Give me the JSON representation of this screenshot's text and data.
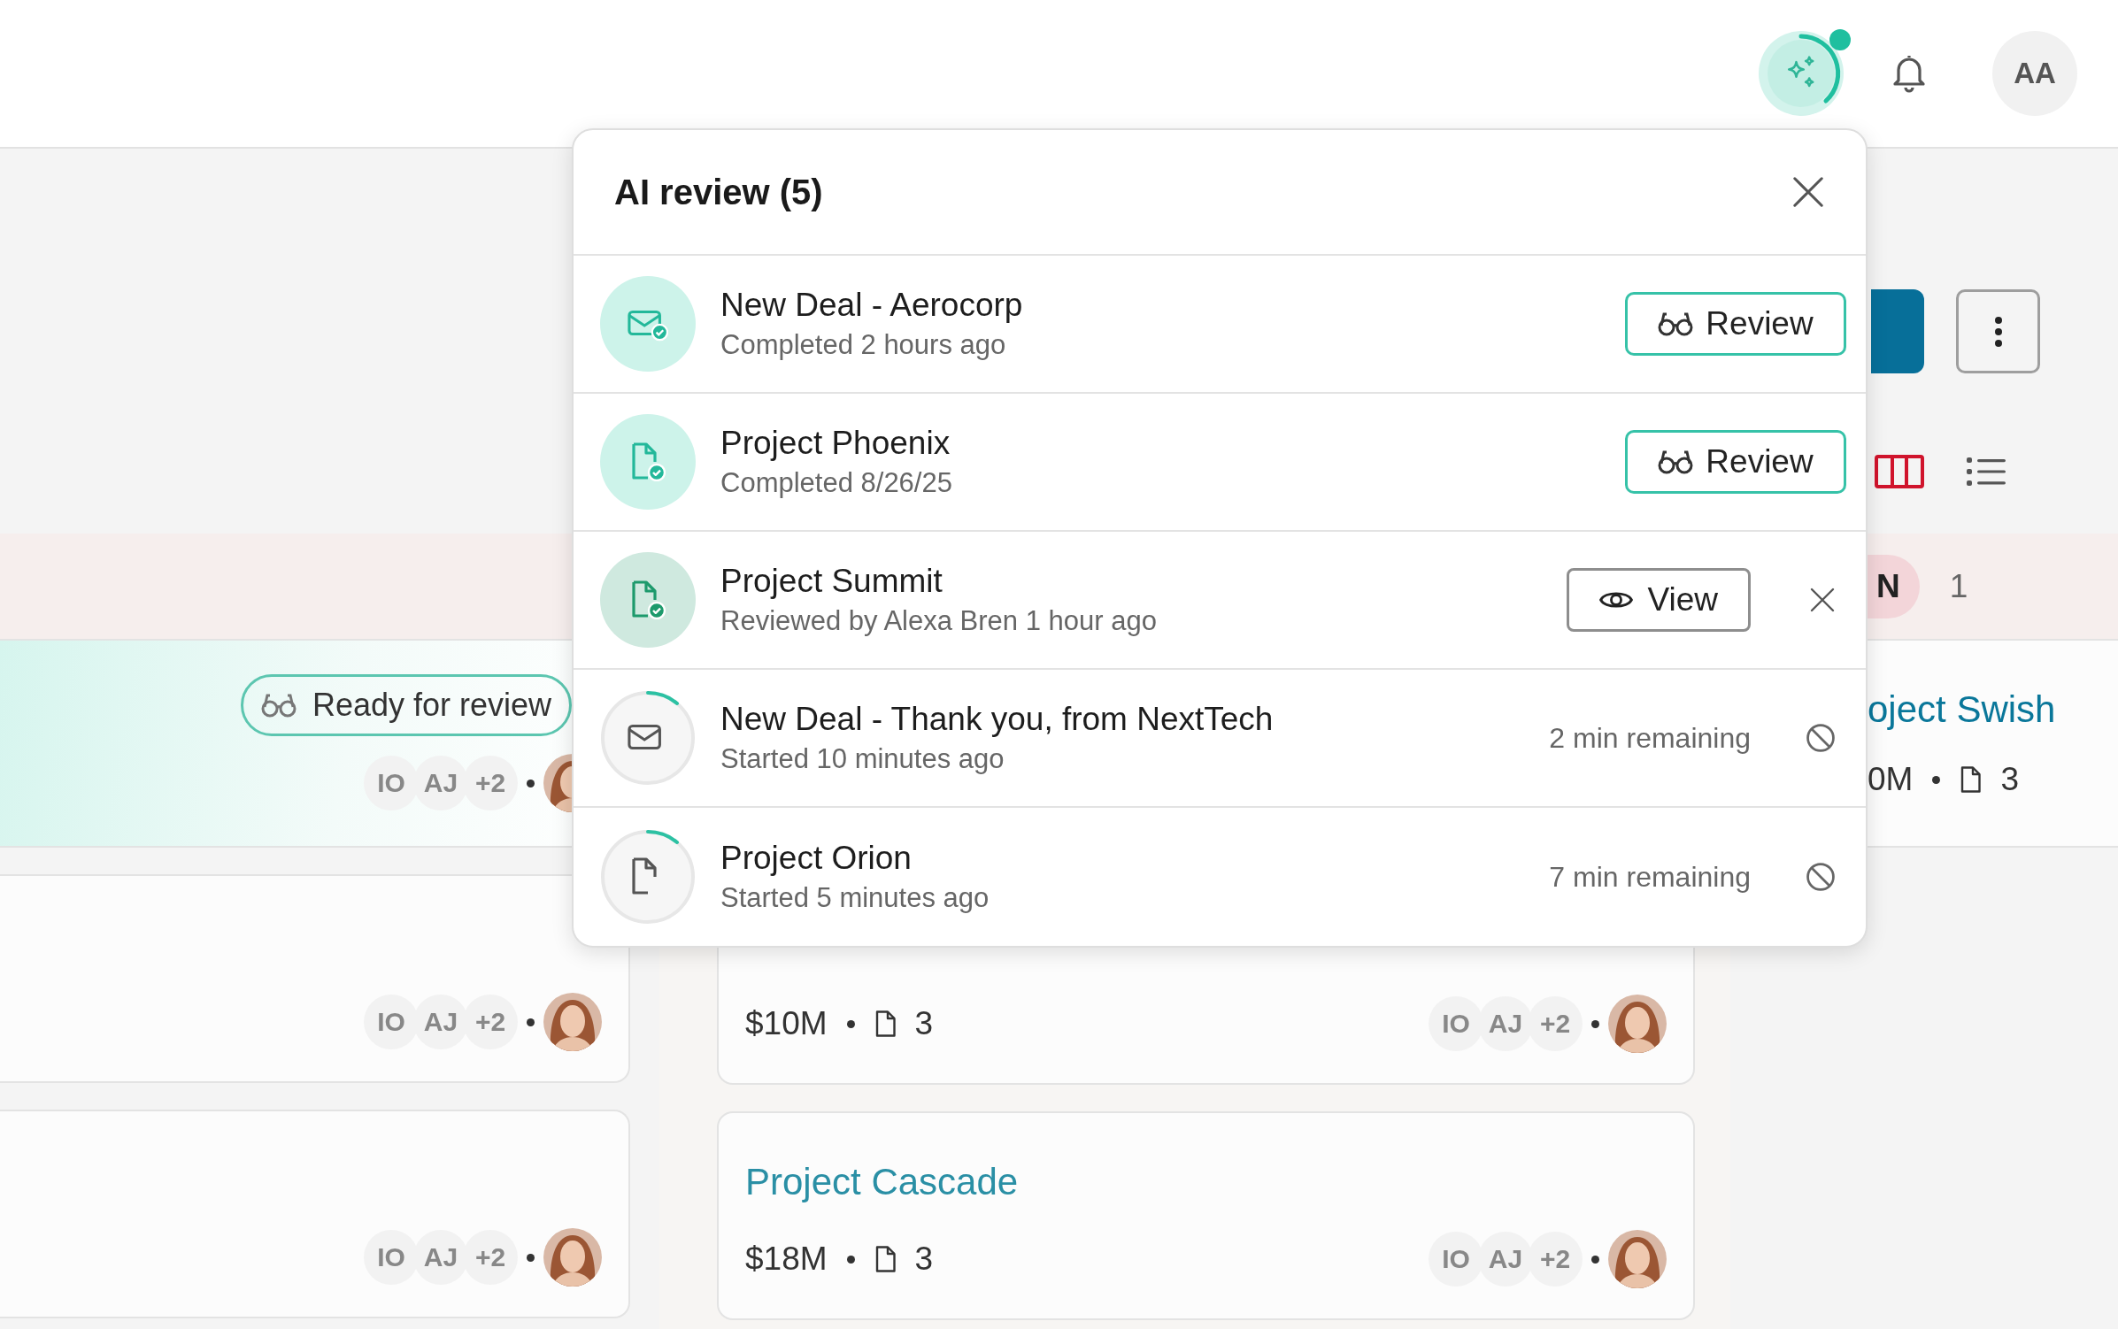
{
  "header": {
    "ai_button": {
      "notification": true
    },
    "user_avatar": "AA"
  },
  "toolbar": {
    "views": [
      {
        "kind": "board",
        "selected": true
      },
      {
        "kind": "list",
        "selected": false
      }
    ]
  },
  "band": {
    "badge": "N",
    "count": "1"
  },
  "lanes": [
    {
      "cards": [
        {
          "highlighted": true,
          "status_chip": "Ready for review",
          "people": [
            "IO",
            "AJ",
            "+2"
          ]
        },
        {
          "highlighted": false,
          "people": [
            "IO",
            "AJ",
            "+2"
          ]
        },
        {
          "highlighted": false,
          "people": [
            "IO",
            "AJ",
            "+2"
          ]
        }
      ]
    },
    {
      "cards": [
        {
          "highlighted": false,
          "amount": "$10M",
          "files": "3",
          "people": [
            "IO",
            "AJ",
            "+2"
          ]
        },
        {
          "highlighted": false,
          "title": "Project Cascade",
          "amount": "$18M",
          "files": "3",
          "people": [
            "IO",
            "AJ",
            "+2"
          ]
        }
      ]
    },
    {
      "cards": [
        {
          "highlighted": false,
          "title": "oject Swish",
          "amount": "0M",
          "files": "3"
        }
      ]
    }
  ],
  "popover": {
    "title": "AI review (5)",
    "items": [
      {
        "kind": "email",
        "reviewed": false,
        "title": "New Deal - Aerocorp",
        "subtitle": "Completed 2 hours ago",
        "action": "Review"
      },
      {
        "kind": "document",
        "reviewed": false,
        "title": "Project Phoenix",
        "subtitle": "Completed 8/26/25",
        "action": "Review"
      },
      {
        "kind": "document",
        "reviewed": true,
        "title": "Project Summit",
        "subtitle": "Reviewed by Alexa Bren 1 hour ago",
        "action": "View"
      },
      {
        "kind": "email",
        "title": "New Deal - Thank you, from NextTech",
        "subtitle": "Started 10 minutes ago",
        "remaining": "2 min remaining"
      },
      {
        "kind": "document",
        "title": "Project Orion",
        "subtitle": "Started 5 minutes ago",
        "remaining": "7 min remaining"
      }
    ]
  }
}
